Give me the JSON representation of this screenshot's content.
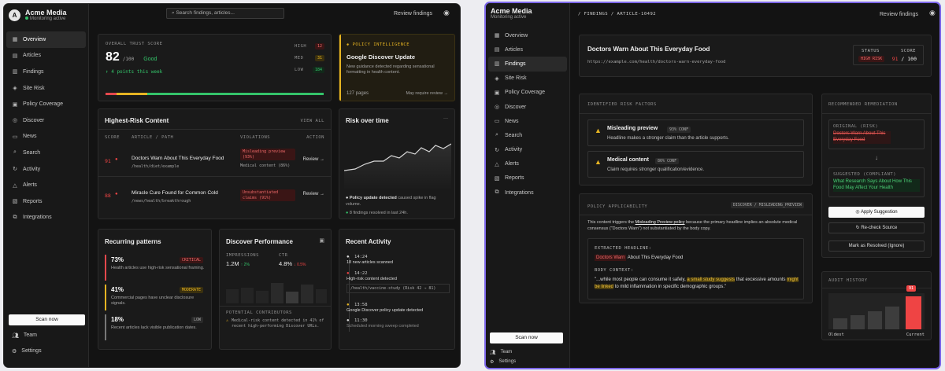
{
  "brand": {
    "initial": "A",
    "name": "Acme Media",
    "status": "Monitoring active"
  },
  "nav1": [
    {
      "icon": "▦",
      "label": "Overview"
    },
    {
      "icon": "▤",
      "label": "Articles"
    },
    {
      "icon": "▥",
      "label": "Findings"
    },
    {
      "icon": "◈",
      "label": "Site Risk"
    },
    {
      "icon": "▣",
      "label": "Policy Coverage"
    },
    {
      "icon": "◎",
      "label": "Discover"
    },
    {
      "icon": "▭",
      "label": "News"
    },
    {
      "icon": "⌕",
      "label": "Search"
    },
    {
      "icon": "↻",
      "label": "Activity"
    },
    {
      "icon": "△",
      "label": "Alerts"
    },
    {
      "icon": "▧",
      "label": "Reports"
    },
    {
      "icon": "⧉",
      "label": "Integrations"
    }
  ],
  "scan_label": "Scan now",
  "team_label": "Team",
  "settings_label": "Settings",
  "search_placeholder": "Search findings, articles...",
  "review_findings": "Review findings",
  "trust": {
    "label": "OVERALL TRUST SCORE",
    "score": "82",
    "max": "/100",
    "rating": "Good",
    "delta": "↑ 4 points this week",
    "levels": [
      {
        "label": "HIGH",
        "value": "12"
      },
      {
        "label": "MED",
        "value": "31"
      },
      {
        "label": "LOW",
        "value": "184"
      }
    ]
  },
  "policy_intel": {
    "label": "POLICY INTELLIGENCE",
    "title": "Google Discover Update",
    "body": "New guidance detected regarding sensational formatting in health content.",
    "pages": "127 pages",
    "action": "May require review"
  },
  "highest": {
    "title": "Highest-Risk Content",
    "view_all": "VIEW ALL",
    "cols": [
      "SCORE",
      "ARTICLE / PATH",
      "VIOLATIONS",
      "ACTION"
    ],
    "rows": [
      {
        "score": "91",
        "title": "Doctors Warn About This Everyday Food",
        "path": "/health/diet/example",
        "v1": "Misleading preview (93%)",
        "v2": "Medical content (86%)",
        "action": "Review"
      },
      {
        "score": "88",
        "title": "Miracle Cure Found for Common Cold",
        "path": "/news/health/breakthrough",
        "v1": "Unsubstantiated claims (91%)",
        "v2": "",
        "action": "Review"
      }
    ]
  },
  "risk_over_time": {
    "title": "Risk over time",
    "menu": "···",
    "notes": [
      {
        "bold": "Policy update detected",
        "rest": "caused spike in flag volume."
      },
      {
        "bold": "",
        "rest": "8 findings resolved in last 24h."
      }
    ]
  },
  "patterns": {
    "title": "Recurring patterns",
    "items": [
      {
        "pct": "73%",
        "tag": "CRITICAL",
        "text": "Health articles use high-risk sensational framing."
      },
      {
        "pct": "41%",
        "tag": "MODERATE",
        "text": "Commercial pages have unclear disclosure signals."
      },
      {
        "pct": "18%",
        "tag": "LOW",
        "text": "Recent articles lack visible publication dates."
      }
    ]
  },
  "discover": {
    "title": "Discover Performance",
    "impr_label": "IMPRESSIONS",
    "impr": "1.2M",
    "impr_delta": "↑ 2%",
    "ctr_label": "CTR",
    "ctr": "4.8%",
    "ctr_delta": "↓ 0.5%",
    "contrib_label": "POTENTIAL CONTRIBUTORS",
    "contrib": "Medical-risk content detected in 41% of recent high-performing Discover URLs."
  },
  "activity": {
    "title": "Recent Activity",
    "items": [
      {
        "time": "14:24",
        "text": "18 new articles scanned",
        "sub": ""
      },
      {
        "time": "14:22",
        "text": "High-risk content detected",
        "sub": "/health/vaccine-study (Risk 42 → 81)"
      },
      {
        "time": "13:58",
        "text": "Google Discover policy update detected",
        "sub": ""
      },
      {
        "time": "11:30",
        "text": "Scheduled morning sweep completed",
        "sub": ""
      }
    ]
  },
  "nav2": [
    {
      "icon": "▦",
      "label": "Overview"
    },
    {
      "icon": "▤",
      "label": "Articles"
    },
    {
      "icon": "▥",
      "label": "Findings"
    },
    {
      "icon": "◈",
      "label": "Site Risk"
    },
    {
      "icon": "▣",
      "label": "Policy Coverage"
    },
    {
      "icon": "◎",
      "label": "Discover"
    },
    {
      "icon": "▭",
      "label": "News"
    },
    {
      "icon": "⌕",
      "label": "Search"
    },
    {
      "icon": "↻",
      "label": "Activity"
    },
    {
      "icon": "△",
      "label": "Alerts"
    },
    {
      "icon": "▧",
      "label": "Reports"
    },
    {
      "icon": "⧉",
      "label": "Integrations"
    }
  ],
  "breadcrumb": "/ FINDINGS / ARTICLE-10492",
  "article": {
    "title": "Doctors Warn About This Everyday Food",
    "url": "https://example.com/health/doctors-warn-everyday-food",
    "status_label": "STATUS",
    "status": "HIGH RISK",
    "score_label": "SCORE",
    "score": "91",
    "score_max": "/ 100"
  },
  "risk_factors": {
    "label": "IDENTIFIED RISK FACTORS",
    "items": [
      {
        "title": "Misleading preview",
        "conf": "93% CONF",
        "desc": "Headline makes a stronger claim than the article supports."
      },
      {
        "title": "Medical content",
        "conf": "86% CONF",
        "desc": "Claim requires stronger qualification/evidence."
      }
    ]
  },
  "remediation": {
    "label": "RECOMMENDED REMEDIATION",
    "orig_label": "ORIGINAL (RISK)",
    "orig": "Doctors Warn About This Everyday Food",
    "sugg_label": "SUGGESTED (COMPLIANT)",
    "sugg": "What Research Says About How This Food May Affect Your Health",
    "apply": "Apply Suggestion",
    "recheck": "Re-check Source",
    "resolve": "Mark as Resolved (Ignore)"
  },
  "applicability": {
    "label": "POLICY APPLICABILITY",
    "tag": "DISCOVER / MISLEADING_PREVIEW",
    "p1": "This content triggers the",
    "link": "Misleading Preview policy",
    "p2": "because the primary headline implies an absolute medical consensus (\"Doctors Warn\") not substantiated by the body copy.",
    "eh_label": "EXTRACTED HEADLINE:",
    "eh_mark": "Doctors Warn",
    "eh_rest": "About This Everyday Food",
    "bc_label": "BODY CONTEXT:",
    "bc1": "\"...while most people can consume it safely,",
    "bc_hl1": "a small study suggests",
    "bc2": "that excessive amounts",
    "bc_hl2": "might be linked",
    "bc3": "to mild inflammation in specific demographic groups.\""
  },
  "audit": {
    "label": "AUDIT HISTORY",
    "value": "91",
    "oldest": "Oldest",
    "current": "Current"
  }
}
